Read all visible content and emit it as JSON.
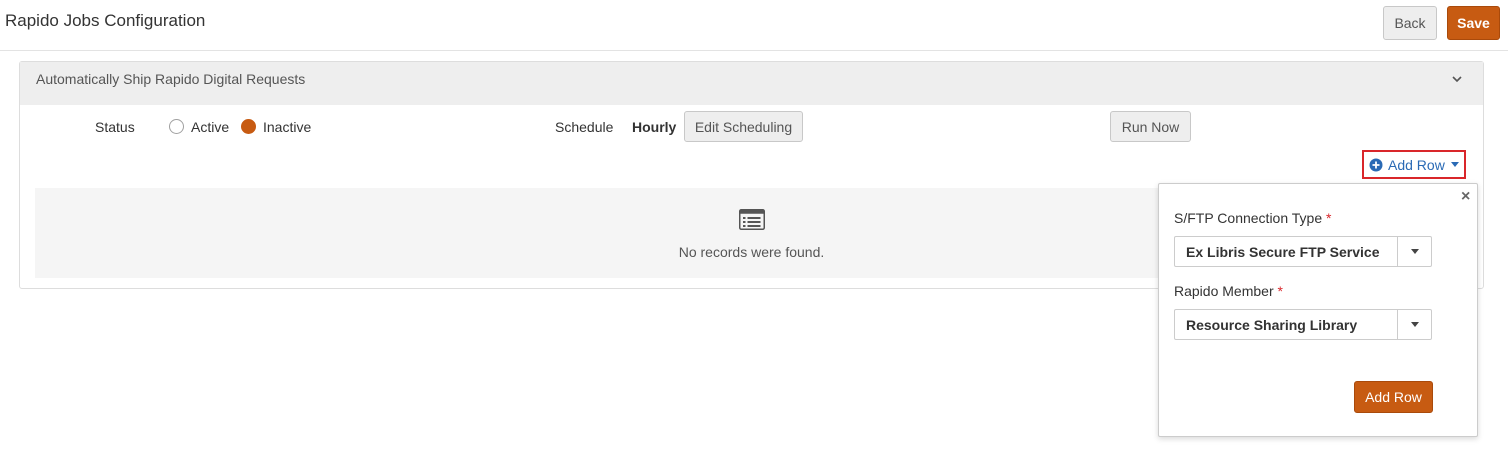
{
  "header": {
    "title": "Rapido Jobs Configuration",
    "back_label": "Back",
    "save_label": "Save"
  },
  "panel": {
    "title": "Automatically Ship Rapido Digital Requests",
    "status_label": "Status",
    "status_options": [
      "Active",
      "Inactive"
    ],
    "status_selected": "Inactive",
    "schedule_label": "Schedule",
    "schedule_value": "Hourly",
    "edit_scheduling_label": "Edit Scheduling",
    "run_now_label": "Run Now",
    "add_row_label": "Add Row",
    "empty_message": "No records were found."
  },
  "popover": {
    "connection_type_label": "S/FTP Connection Type",
    "connection_type_value": "Ex Libris Secure FTP Service",
    "member_label": "Rapido Member",
    "member_value": "Resource Sharing Library",
    "required_mark": "*",
    "close_glyph": "×",
    "submit_label": "Add Row"
  },
  "colors": {
    "accent": "#c75b12",
    "link": "#2a6ab5",
    "highlight_border": "#d9262a"
  },
  "icons": [
    "chevron-down-icon",
    "plus-circle-icon",
    "caret-down-icon",
    "list-icon",
    "close-icon"
  ]
}
